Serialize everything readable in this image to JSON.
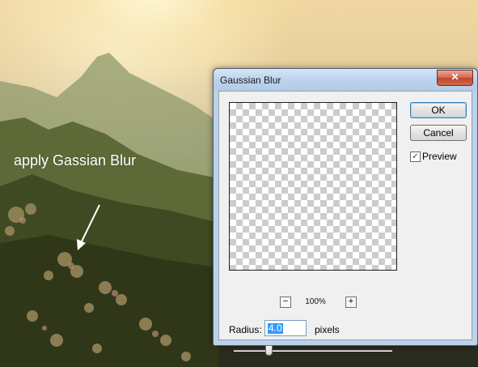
{
  "annotation": {
    "text": "apply Gassian Blur"
  },
  "dialog": {
    "title": "Gaussian Blur",
    "close_icon": "✕",
    "ok_label": "OK",
    "cancel_label": "Cancel",
    "preview_checked": true,
    "preview_check_glyph": "✓",
    "preview_label": "Preview",
    "zoom_out_label": "−",
    "zoom_in_label": "+",
    "zoom_level": "100%",
    "radius_label": "Radius:",
    "radius_value": "4.0",
    "radius_unit": "pixels",
    "radius_slider_fraction": 0.22
  },
  "icons": [
    "close-icon",
    "check-icon",
    "zoom-out-icon",
    "zoom-in-icon",
    "arrow-icon"
  ],
  "colors": {
    "selection": "#3399ff",
    "close_button": "#c0452c",
    "title_bar": "#bcd3ec"
  }
}
